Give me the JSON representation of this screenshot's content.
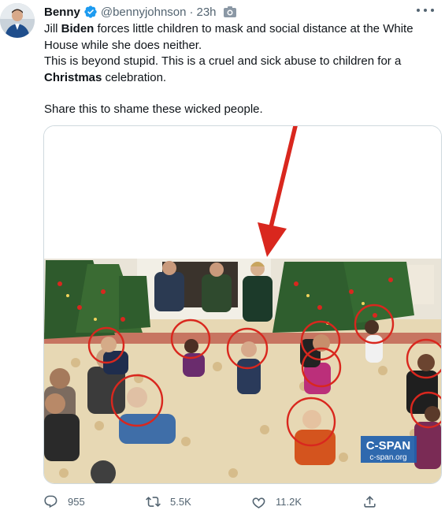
{
  "author": {
    "name": "Benny",
    "handle": "@bennyjohnson",
    "separator": "·",
    "time": "23h"
  },
  "tweet": {
    "line1_before": "Jill ",
    "line1_bold": "Biden",
    "line1_after": " forces little children to mask and social distance at the White House while she does neither.",
    "line2": "This is beyond stupid. This is a cruel and sick abuse to children for a ",
    "line2_bold": "Christmas",
    "line2_after": " celebration.",
    "line3": "Share this to shame these wicked people."
  },
  "media": {
    "watermark_brand": "C-SPAN",
    "watermark_url": "c-span.org"
  },
  "actions": {
    "replies": "955",
    "retweets": "5.5K",
    "likes": "11.2K"
  },
  "colors": {
    "verified": "#1d9bf0",
    "secondary_text": "#536471",
    "annotation_red": "#d9271e",
    "cspan_blue": "#1f5fae"
  },
  "icons": [
    "verified-badge-icon",
    "camera-icon",
    "more-icon",
    "reply-icon",
    "retweet-icon",
    "like-icon",
    "share-icon"
  ]
}
